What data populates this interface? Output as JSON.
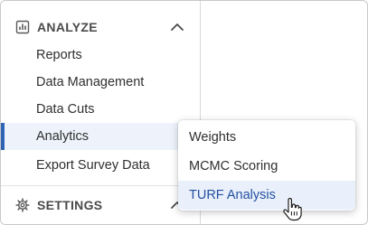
{
  "sidebar": {
    "analyze": {
      "title": "ANALYZE",
      "icon": "bar-chart-icon",
      "chevron": "chevron-up-icon",
      "expanded": true
    },
    "items": [
      {
        "label": "Reports"
      },
      {
        "label": "Data Management"
      },
      {
        "label": "Data Cuts"
      },
      {
        "label": "Analytics",
        "active": true
      },
      {
        "label": "Export Survey Data"
      }
    ],
    "settings": {
      "title": "SETTINGS",
      "icon": "gear-icon",
      "chevron": "chevron-up-icon"
    }
  },
  "analytics_menu": {
    "items": [
      {
        "label": "Weights"
      },
      {
        "label": "MCMC Scoring"
      },
      {
        "label": "TURF Analysis",
        "hovered": true
      }
    ]
  },
  "colors": {
    "active_accent": "#2f63b3",
    "active_bg": "#eef3fb",
    "hover_bg": "#e9f0fb",
    "hover_text": "#2450a0"
  },
  "cursor": {
    "icon": "hand-pointer-icon"
  }
}
